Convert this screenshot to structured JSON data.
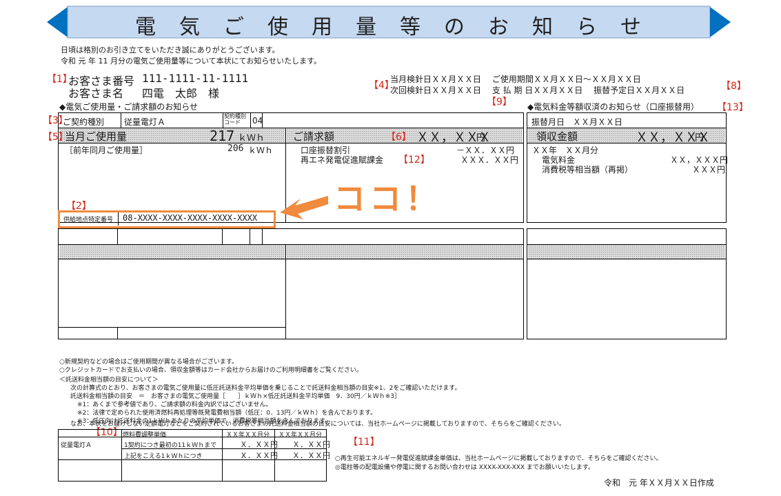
{
  "title": "電　気　ご　使　用　量　等　の　お　知　ら　せ",
  "colors": {
    "banner_fill": "#c5d9f1",
    "banner_arrow": "#0070c0",
    "marker_red": "#d62518",
    "highlight_orange": "#f08a3c"
  },
  "intro": {
    "line1": "日頃は格別のお引き立てをいただき誠にありがとうございます。",
    "line2": "令和 元 年 11 月分の電気ご使用量等について本状にてお知らせいたします。"
  },
  "markers": {
    "m1": "【1】",
    "m2": "【2】",
    "m3": "【3】",
    "m4": "【4】",
    "m5": "【5】",
    "m6": "【6】",
    "m8": "【8】",
    "m9": "【9】",
    "m10": "【10】",
    "m11": "【11】",
    "m12": "【12】",
    "m13": "【13】"
  },
  "customer": {
    "number_label": "お客さま番号",
    "number_value": "111-1111-11-1111",
    "name_label": "お客さま名",
    "name_value": "四電　太郎　様"
  },
  "meter": {
    "row1": "当月検針日ＸＸ月ＸＸ日　 ご使用期間ＸＸ月ＸＸ日～ＸＸ月ＸＸ日",
    "row2": "次回検針日ＸＸ月ＸＸ日　 支 払 期 日ＸＸ月ＸＸ日　 振替予定日ＸＸ月ＸＸ日"
  },
  "section_left_title": "◆電気ご使用量・ご請求額のお知らせ",
  "section_right_title": "◆電気料金等額収済のお知らせ（口座振替用）",
  "contract": {
    "type_label": "ご契約種別",
    "type_value": "従量電灯Ａ",
    "class_label": "契約種別コード",
    "class_value": "04"
  },
  "usage": {
    "label": "当月ご使用量",
    "value": "217",
    "unit": "ｋＷｈ",
    "prev_label": "［前年同月ご使用量］",
    "prev_value": "206",
    "prev_unit": "ｋＷｈ"
  },
  "billing": {
    "label": "ご請求額",
    "amount": "ＸＸ，ＸＸＸ",
    "yen": "円",
    "items": [
      {
        "label": "口座振替割引",
        "value": "－ＸＸ．ＸＸ円"
      },
      {
        "label": "再エネ発電促進賦課金",
        "value": "ＸＸＸ．ＸＸ円"
      }
    ]
  },
  "supply_point": {
    "label": "供給地点特定番号",
    "value": "08-XXXX-XXXX-XXXX-XXXX-XXXX"
  },
  "callout": "ココ！",
  "receipt": {
    "transfer_date": "振替月日　ＸＸ月ＸＸ日",
    "label": "領収金額",
    "amount": "ＸＸ，ＸＸＸ",
    "yen": "円",
    "period": "ＸＸ年　ＸＸ月分",
    "items": [
      {
        "label": "電気料金",
        "value": "ＸＸ，ＸＸＸ円"
      },
      {
        "label": "消費税等相当額（再掲）",
        "value": "ＸＸＸ円"
      }
    ]
  },
  "notes": {
    "n1": "○新規契約などの場合はご使用期間が異なる場合がございます。",
    "n2": "○クレジットカードでお支払いの場合、領収金額等はカード会社からお届けのご利用明細書をご覧ください。",
    "n3": "＜託送料金相当額の目安について＞",
    "n4": "次の計算式のとおり、お客さまの電気ご使用量に低圧託送料金平均単価を乗じることで託送料金相当額の目安※1、2をご確認いただけます。",
    "n5": "託送料金相当額の目安　＝　お客さまの電気ご使用量［　　］ｋＷｈ×低圧託送料金平均単価　9．30円／ｋＷｈ※3］",
    "n6": "※1：あくまで参考値であり、ご請求額の料金内訳ではございません。",
    "n7": "※2：法律で定められた使用済燃料再処理等既発電費相当額（低圧：0．13円／ｋＷｈ）を含んでおります。",
    "n8": "※3：低圧向け託送料金の1ｋＷｈあたりの平均単価で、消費税等相当額を含んでおります。",
    "n9": "なお、本状をお届けしない定額電灯などをご契約されているお客さまの託送料金相当額の目安については、当社ホームページに掲載しておりますので、そちらをご確認ください。"
  },
  "fuel_table": {
    "header": [
      "燃料費調整単価",
      "ＸＸ年ＸＸ月分",
      "ＸＸ年ＸＸ月分"
    ],
    "contract": "従量電灯Ａ",
    "rows": [
      {
        "label": "1契約につき最初の11ｋＷｈまで",
        "v1": "Ｘ．ＸＸ円",
        "v2": "Ｘ．ＸＸ円"
      },
      {
        "label": "上記をこえる1ｋＷｈにつき",
        "v1": "Ｘ．ＸＸ円",
        "v2": "Ｘ．ＸＸ円"
      }
    ]
  },
  "bottom_notes": {
    "b1": "○再生可能エネルギー発電促進賦課金単価は、当社ホームページに掲載しておりますので、そちらをご確認ください。",
    "b2": "◎電柱等の配電設備や停電に関するお問い合わせは XXXX-XXX-XXX までお願いいたします。"
  },
  "created": "令和　元 年ＸＸ月ＸＸ日作成"
}
